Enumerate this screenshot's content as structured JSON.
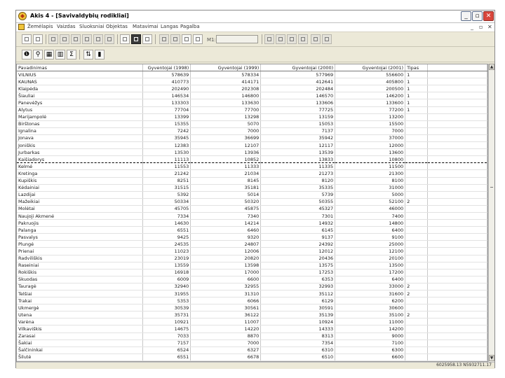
{
  "window": {
    "title": "Akis 4 - [Savivaldybių rodikliai]",
    "controls": {
      "minimize": "_",
      "restore": "▫",
      "close": "✕"
    },
    "mdi_controls": [
      "_",
      "▫",
      "✕"
    ]
  },
  "menu": [
    "Žemėlapis",
    "Vaizdas",
    "Sluoksniai",
    "Objektas",
    "Matavimai",
    "Langas",
    "Pagalba"
  ],
  "toolbar2": {
    "scale_label": "M1:"
  },
  "grid": {
    "columns": [
      "Pavadinimas",
      "Gyventojai (1998)",
      "Gyventojai (1999)",
      "Gyventojai (2000)",
      "Gyventojai (2001)",
      "Tipas"
    ],
    "rows": [
      [
        "VILNIUS",
        "578639",
        "578334",
        "577969",
        "556600",
        "1"
      ],
      [
        "KAUNAS",
        "410773",
        "414171",
        "412641",
        "405800",
        "1"
      ],
      [
        "Klaipėda",
        "202490",
        "202308",
        "202484",
        "200500",
        "1"
      ],
      [
        "Šiauliai",
        "146534",
        "146800",
        "146570",
        "146200",
        "1"
      ],
      [
        "Panevėžys",
        "133303",
        "133630",
        "133606",
        "133600",
        "1"
      ],
      [
        "Alytus",
        "77704",
        "77700",
        "77725",
        "77200",
        "1"
      ],
      [
        "Marijampolė",
        "13399",
        "13298",
        "13159",
        "13200",
        ""
      ],
      [
        "Birštonas",
        "15355",
        "5070",
        "15053",
        "15500",
        ""
      ],
      [
        "Ignalina",
        "7242",
        "7000",
        "7137",
        "7000",
        ""
      ],
      [
        "Jonava",
        "35945",
        "36699",
        "35942",
        "37000",
        ""
      ],
      [
        "Joniškis",
        "12383",
        "12107",
        "12117",
        "12000",
        ""
      ],
      [
        "Jurbarkas",
        "13530",
        "13936",
        "13539",
        "13600",
        ""
      ],
      [
        "Kaišiadorys",
        "11113",
        "10852",
        "13833",
        "10800",
        ""
      ],
      [
        "Kelmė",
        "11553",
        "11333",
        "11335",
        "11500",
        ""
      ],
      [
        "Kretinga",
        "21242",
        "21034",
        "21273",
        "21300",
        ""
      ],
      [
        "Kupiškis",
        "8251",
        "8145",
        "8120",
        "8100",
        ""
      ],
      [
        "Kėdainiai",
        "31515",
        "35181",
        "35335",
        "31000",
        ""
      ],
      [
        "Lazdijai",
        "5392",
        "5014",
        "5739",
        "5000",
        ""
      ],
      [
        "Mažeikiai",
        "50334",
        "50320",
        "50355",
        "52100",
        "2"
      ],
      [
        "Molėtai",
        "45705",
        "45875",
        "45327",
        "46000",
        ""
      ],
      [
        "Naujoji Akmenė",
        "7334",
        "7340",
        "7301",
        "7400",
        ""
      ],
      [
        "Pakruojis",
        "14630",
        "14214",
        "14932",
        "14800",
        ""
      ],
      [
        "Palanga",
        "6551",
        "6460",
        "6145",
        "6400",
        ""
      ],
      [
        "Pasvalys",
        "9425",
        "9320",
        "9137",
        "9100",
        ""
      ],
      [
        "Plungė",
        "24535",
        "24807",
        "24392",
        "25000",
        ""
      ],
      [
        "Prienai",
        "11023",
        "12006",
        "12012",
        "12100",
        ""
      ],
      [
        "Radviliškis",
        "23019",
        "20820",
        "20436",
        "20100",
        ""
      ],
      [
        "Raseiniai",
        "13559",
        "13598",
        "13575",
        "13500",
        ""
      ],
      [
        "Rokiškis",
        "16918",
        "17000",
        "17253",
        "17200",
        ""
      ],
      [
        "Skuodas",
        "6009",
        "6600",
        "6353",
        "6400",
        ""
      ],
      [
        "Tauragė",
        "32940",
        "32955",
        "32993",
        "33000",
        "2"
      ],
      [
        "Telšiai",
        "31955",
        "31310",
        "35112",
        "31600",
        "2"
      ],
      [
        "Trakai",
        "5353",
        "6066",
        "6129",
        "6200",
        ""
      ],
      [
        "Ukmergė",
        "30539",
        "30561",
        "30591",
        "30600",
        ""
      ],
      [
        "Utena",
        "35731",
        "36122",
        "35139",
        "35100",
        "2"
      ],
      [
        "Varėna",
        "10921",
        "11007",
        "10924",
        "11000",
        ""
      ],
      [
        "Vilkaviškis",
        "14675",
        "14220",
        "14333",
        "14200",
        ""
      ],
      [
        "Zarasai",
        "7033",
        "8870",
        "8313",
        "9000",
        ""
      ],
      [
        "Šakiai",
        "7157",
        "7000",
        "7354",
        "7100",
        ""
      ],
      [
        "Šalčininkai",
        "6524",
        "6327",
        "6310",
        "6300",
        ""
      ],
      [
        "Šilutė",
        "6551",
        "6678",
        "6510",
        "6600",
        ""
      ],
      [
        "Šilalė",
        "22333",
        "22092",
        "22449",
        "22500",
        ""
      ],
      [
        "Širvintos",
        "7344",
        "7301",
        "7333",
        "7300",
        ""
      ]
    ],
    "selected_row": 12
  },
  "status": {
    "coords": "6025958.13  N5932711.17"
  }
}
